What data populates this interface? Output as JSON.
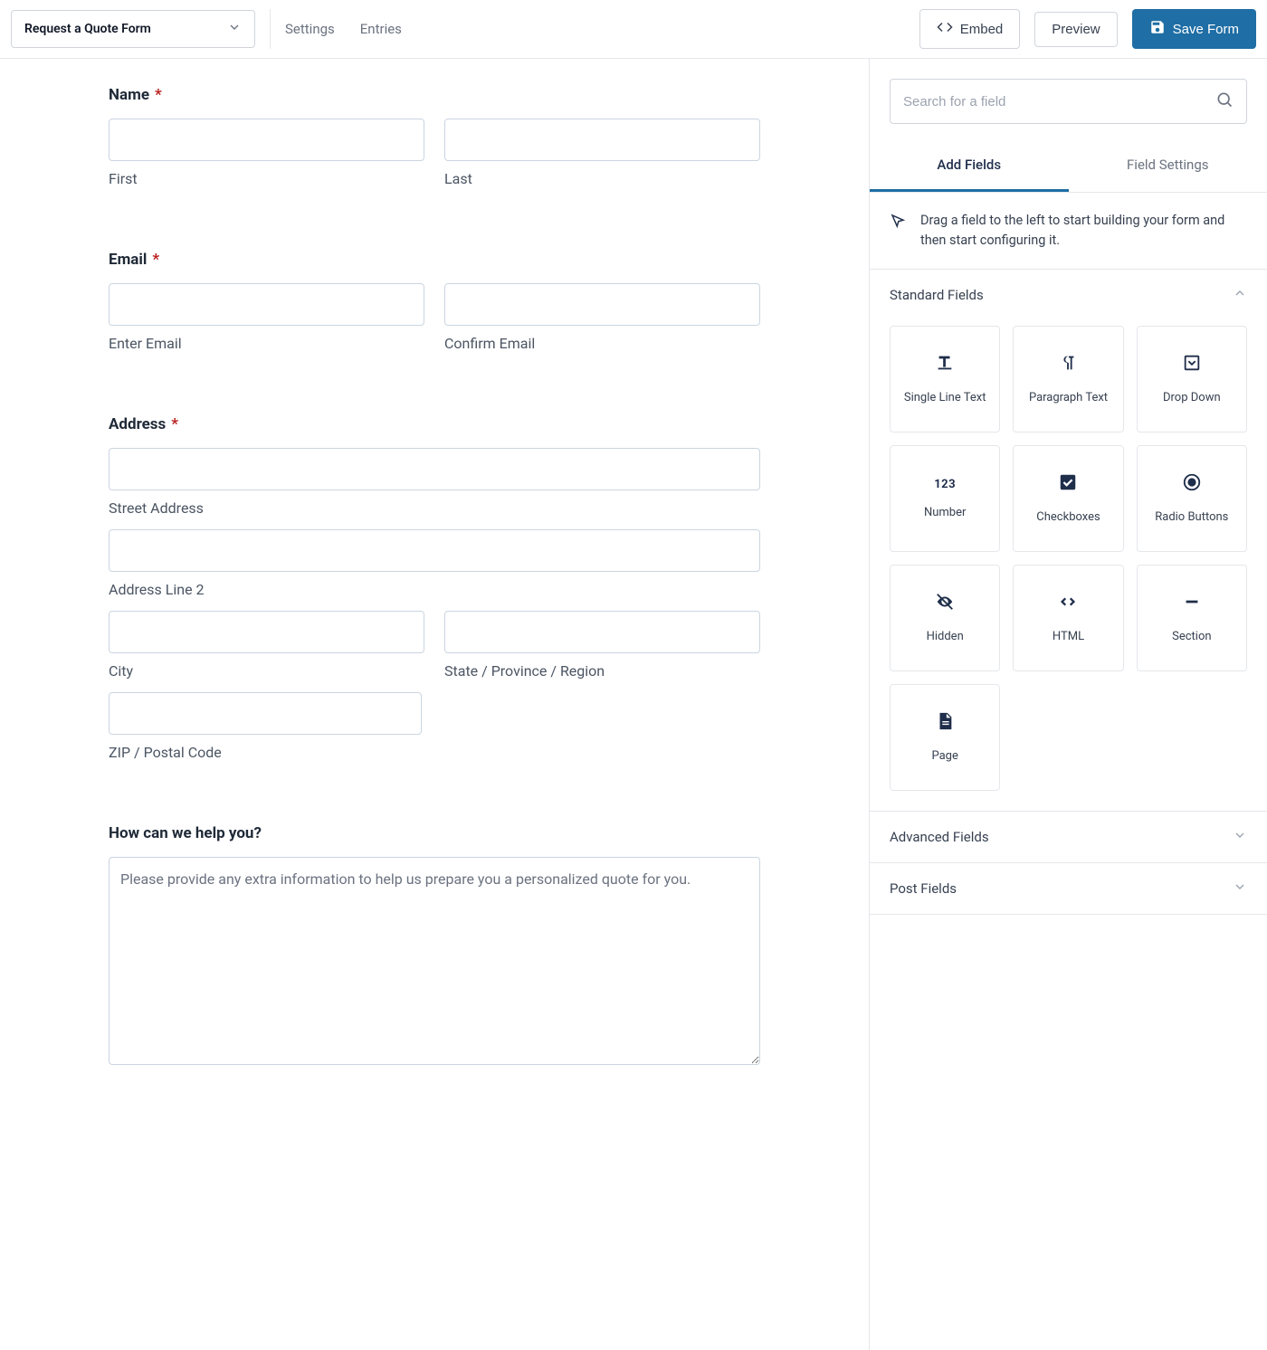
{
  "header": {
    "form_name": "Request a Quote Form",
    "tabs": {
      "settings": "Settings",
      "entries": "Entries"
    },
    "embed": "Embed",
    "preview": "Preview",
    "save": "Save Form"
  },
  "canvas": {
    "name": {
      "label": "Name",
      "first": "First",
      "last": "Last"
    },
    "email": {
      "label": "Email",
      "enter": "Enter Email",
      "confirm": "Confirm Email"
    },
    "address": {
      "label": "Address",
      "street": "Street Address",
      "line2": "Address Line 2",
      "city": "City",
      "state": "State / Province / Region",
      "zip": "ZIP / Postal Code"
    },
    "help": {
      "label": "How can we help you?",
      "placeholder": "Please provide any extra information to help us prepare you a personalized quote for you."
    }
  },
  "sidebar": {
    "search_placeholder": "Search for a field",
    "tabs": {
      "add": "Add Fields",
      "settings": "Field Settings"
    },
    "hint": "Drag a field to the left to start building your form and then start configuring it.",
    "sections": {
      "standard": "Standard Fields",
      "advanced": "Advanced Fields",
      "post": "Post Fields"
    },
    "fields": {
      "single_line": "Single Line Text",
      "paragraph": "Paragraph Text",
      "dropdown": "Drop Down",
      "number": "Number",
      "checkboxes": "Checkboxes",
      "radio": "Radio Buttons",
      "hidden": "Hidden",
      "html": "HTML",
      "section": "Section",
      "page": "Page"
    }
  }
}
